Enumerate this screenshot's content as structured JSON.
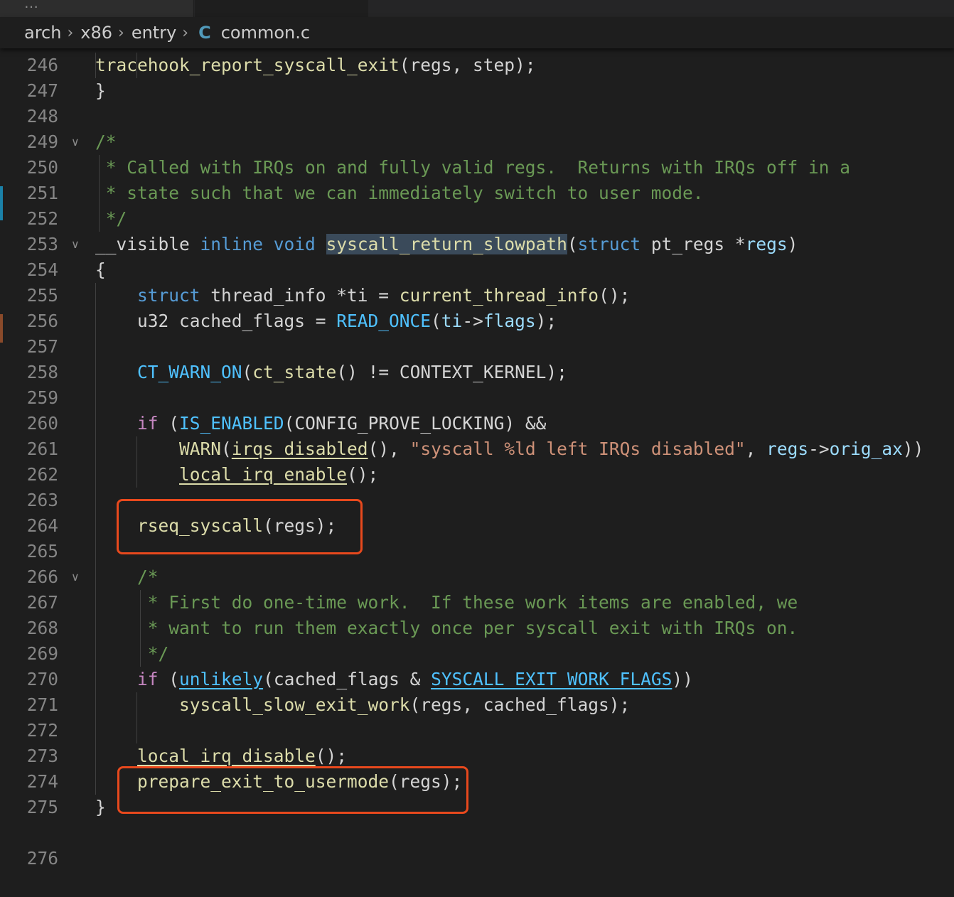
{
  "breadcrumb": {
    "items": [
      "arch",
      "x86",
      "entry"
    ],
    "file_icon": "C",
    "file": "common.c"
  },
  "tab_overflow": "…",
  "colors": {
    "keyword": "#569cd6",
    "control": "#c586c0",
    "function": "#dcdcaa",
    "macro": "#4fc1ff",
    "variable": "#9cdcfe",
    "string": "#ce9178",
    "comment": "#6a9955",
    "highlight_box": "#e8491d"
  },
  "partial_line_number": "276",
  "lines": [
    {
      "n": "246",
      "tokens": [
        [
          "fn",
          "tracehook_report_syscall_exit"
        ],
        [
          "",
          "(regs, step);"
        ]
      ]
    },
    {
      "n": "247",
      "tokens": [
        [
          "",
          "}"
        ]
      ]
    },
    {
      "n": "248",
      "tokens": []
    },
    {
      "n": "249",
      "tokens": [
        [
          "cm",
          "/*"
        ]
      ]
    },
    {
      "n": "250",
      "tokens": [
        [
          "cm",
          " * Called with IRQs on and fully valid regs.  Returns with IRQs off in a"
        ]
      ]
    },
    {
      "n": "251",
      "tokens": [
        [
          "cm",
          " * state such that we can immediately switch to user mode."
        ]
      ]
    },
    {
      "n": "252",
      "tokens": [
        [
          "cm",
          " */"
        ]
      ]
    },
    {
      "n": "253",
      "tokens": [
        [
          "",
          "__visible "
        ],
        [
          "kw",
          "inline"
        ],
        [
          "",
          " "
        ],
        [
          "kw",
          "void"
        ],
        [
          "",
          " "
        ],
        [
          "fn hl",
          "syscall_return_slowpath"
        ],
        [
          "",
          "("
        ],
        [
          "kw",
          "struct"
        ],
        [
          "",
          " pt_regs *"
        ],
        [
          "var",
          "regs"
        ],
        [
          "",
          ")"
        ]
      ]
    },
    {
      "n": "254",
      "tokens": [
        [
          "",
          "{"
        ]
      ]
    },
    {
      "n": "255",
      "tokens": [
        [
          "",
          "    "
        ],
        [
          "kw",
          "struct"
        ],
        [
          "",
          " thread_info *ti = "
        ],
        [
          "fn",
          "current_thread_info"
        ],
        [
          "",
          "();"
        ]
      ]
    },
    {
      "n": "256",
      "tokens": [
        [
          "",
          "    u32 cached_flags = "
        ],
        [
          "mac",
          "READ_ONCE"
        ],
        [
          "",
          "("
        ],
        [
          "var",
          "ti"
        ],
        [
          "",
          "->"
        ],
        [
          "var",
          "flags"
        ],
        [
          "",
          ");"
        ]
      ]
    },
    {
      "n": "257",
      "tokens": []
    },
    {
      "n": "258",
      "tokens": [
        [
          "",
          "    "
        ],
        [
          "mac",
          "CT_WARN_ON"
        ],
        [
          "",
          "("
        ],
        [
          "fn",
          "ct_state"
        ],
        [
          "",
          "() != CONTEXT_KERNEL);"
        ]
      ]
    },
    {
      "n": "259",
      "tokens": []
    },
    {
      "n": "260",
      "tokens": [
        [
          "",
          "    "
        ],
        [
          "ctl",
          "if"
        ],
        [
          "",
          " ("
        ],
        [
          "mac",
          "IS_ENABLED"
        ],
        [
          "",
          "(CONFIG_PROVE_LOCKING) &&"
        ]
      ]
    },
    {
      "n": "261",
      "tokens": [
        [
          "",
          "        "
        ],
        [
          "fn",
          "WARN"
        ],
        [
          "",
          "("
        ],
        [
          "fn ul",
          "irqs_disabled"
        ],
        [
          "",
          "(), "
        ],
        [
          "str",
          "\"syscall %ld left IRQs disabled\""
        ],
        [
          "",
          ", "
        ],
        [
          "var",
          "regs"
        ],
        [
          "",
          "->"
        ],
        [
          "var",
          "orig_ax"
        ],
        [
          "",
          "))"
        ]
      ]
    },
    {
      "n": "262",
      "tokens": [
        [
          "",
          "        "
        ],
        [
          "fn ul",
          "local_irq_enable"
        ],
        [
          "",
          "();"
        ]
      ]
    },
    {
      "n": "263",
      "tokens": []
    },
    {
      "n": "264",
      "tokens": [
        [
          "",
          "    "
        ],
        [
          "fn",
          "rseq_syscall"
        ],
        [
          "",
          "(regs);"
        ]
      ]
    },
    {
      "n": "265",
      "tokens": []
    },
    {
      "n": "266",
      "tokens": [
        [
          "",
          "    "
        ],
        [
          "cm",
          "/*"
        ]
      ]
    },
    {
      "n": "267",
      "tokens": [
        [
          "",
          "    "
        ],
        [
          "cm",
          " * First do one-time work.  If these work items are enabled, we"
        ]
      ]
    },
    {
      "n": "268",
      "tokens": [
        [
          "",
          "    "
        ],
        [
          "cm",
          " * want to run them exactly once per syscall exit with IRQs on."
        ]
      ]
    },
    {
      "n": "269",
      "tokens": [
        [
          "",
          "    "
        ],
        [
          "cm",
          " */"
        ]
      ]
    },
    {
      "n": "270",
      "tokens": [
        [
          "",
          "    "
        ],
        [
          "ctl",
          "if"
        ],
        [
          "",
          " ("
        ],
        [
          "mac ulm",
          "unlikely"
        ],
        [
          "",
          "(cached_flags & "
        ],
        [
          "mac ulm",
          "SYSCALL_EXIT_WORK_FLAGS"
        ],
        [
          "",
          "))"
        ]
      ]
    },
    {
      "n": "271",
      "tokens": [
        [
          "",
          "        "
        ],
        [
          "fn",
          "syscall_slow_exit_work"
        ],
        [
          "",
          "(regs, cached_flags);"
        ]
      ]
    },
    {
      "n": "272",
      "tokens": []
    },
    {
      "n": "273",
      "tokens": [
        [
          "",
          "    "
        ],
        [
          "fn ul",
          "local_irq_disable"
        ],
        [
          "",
          "();"
        ]
      ]
    },
    {
      "n": "274",
      "tokens": [
        [
          "",
          "    "
        ],
        [
          "fn",
          "prepare_exit_to_usermode"
        ],
        [
          "",
          "(regs);"
        ]
      ]
    },
    {
      "n": "275",
      "tokens": [
        [
          "",
          "}"
        ]
      ]
    }
  ]
}
